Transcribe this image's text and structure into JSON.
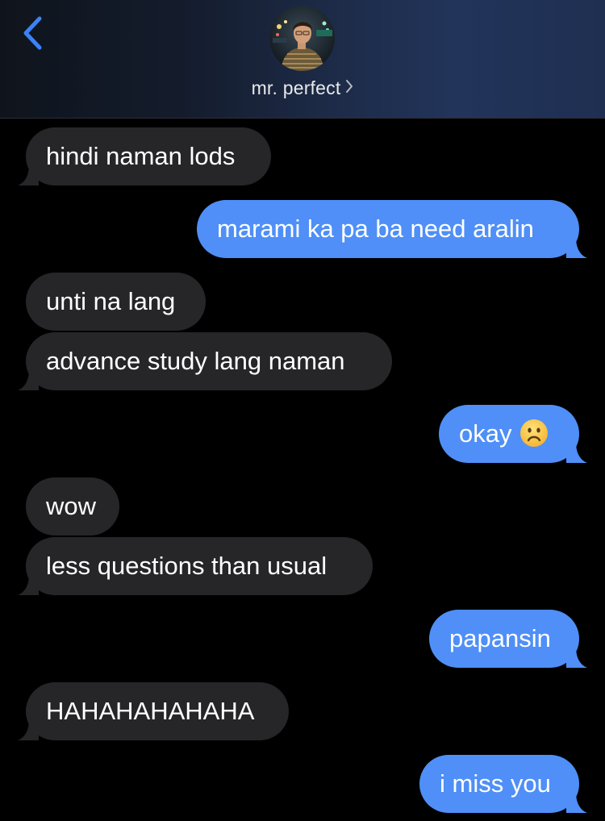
{
  "header": {
    "back_icon": "chevron-left-icon",
    "contact_name": "mr. perfect",
    "name_chevron_icon": "chevron-right-icon",
    "accent_color": "#3b82f6"
  },
  "colors": {
    "incoming_bubble": "#262629",
    "outgoing_bubble": "#4f8ff7",
    "background": "#000000"
  },
  "messages": [
    {
      "direction": "in",
      "text": "hindi naman lods"
    },
    {
      "direction": "out",
      "text": "marami ka pa ba need aralin"
    },
    {
      "direction": "in",
      "text": "unti na lang"
    },
    {
      "direction": "in",
      "text": "advance study lang naman"
    },
    {
      "direction": "out",
      "text": "okay",
      "emoji": "frowning-face-emoji"
    },
    {
      "direction": "in",
      "text": "wow"
    },
    {
      "direction": "in",
      "text": "less questions than usual"
    },
    {
      "direction": "out",
      "text": "papansin"
    },
    {
      "direction": "in",
      "text": "HAHAHAHAHAHA"
    },
    {
      "direction": "out",
      "text": "i miss you"
    }
  ]
}
